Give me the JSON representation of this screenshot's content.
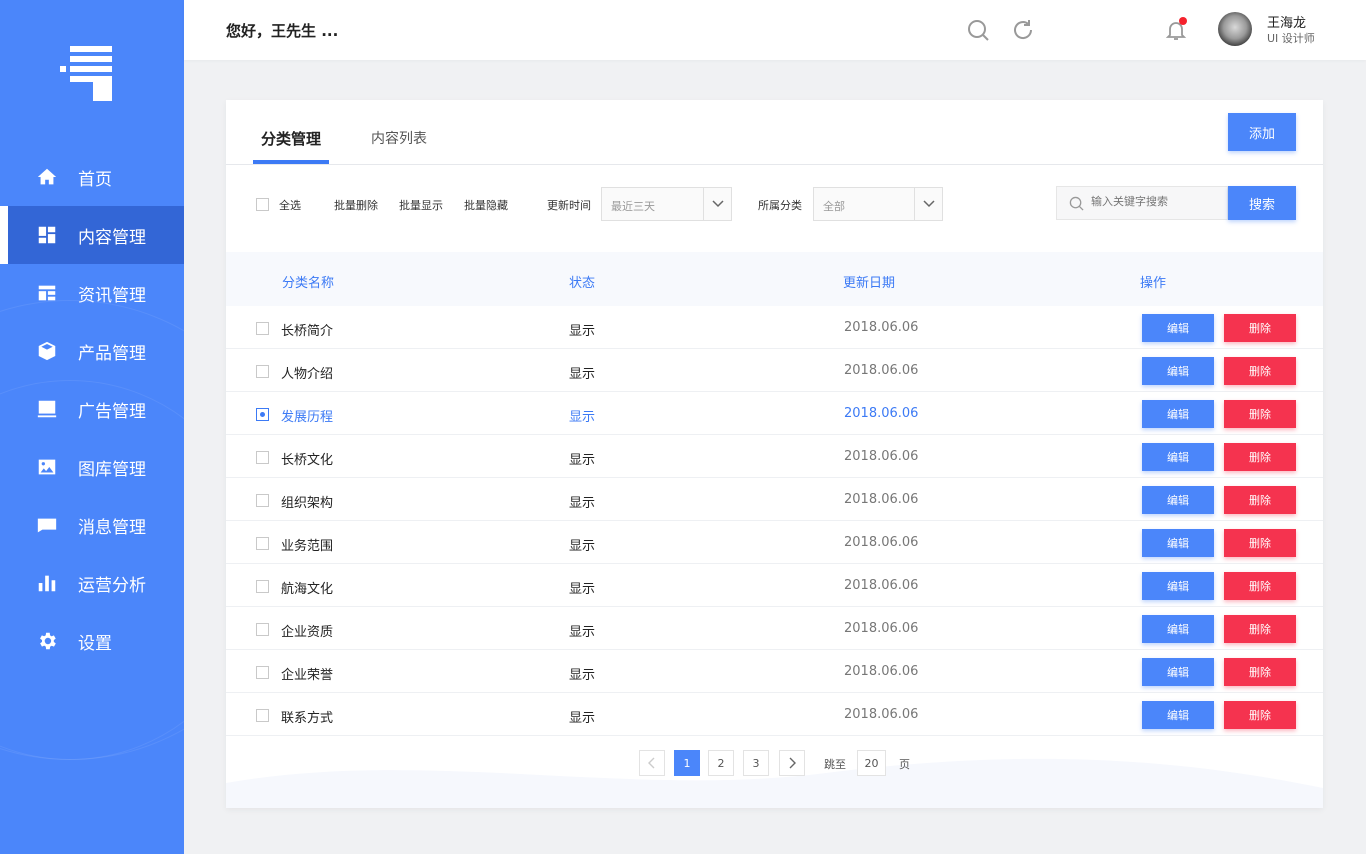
{
  "header": {
    "greeting": "您好，王先生 ...",
    "user_name": "王海龙",
    "user_role": "UI 设计师"
  },
  "sidebar": {
    "items": [
      {
        "label": "首页",
        "icon": "home-icon"
      },
      {
        "label": "内容管理",
        "icon": "dashboard-icon",
        "active": true
      },
      {
        "label": "资讯管理",
        "icon": "news-icon"
      },
      {
        "label": "产品管理",
        "icon": "box-icon"
      },
      {
        "label": "广告管理",
        "icon": "monitor-icon"
      },
      {
        "label": "图库管理",
        "icon": "image-icon"
      },
      {
        "label": "消息管理",
        "icon": "message-icon"
      },
      {
        "label": "运营分析",
        "icon": "bar-chart-icon"
      },
      {
        "label": "设置",
        "icon": "gear-icon"
      }
    ]
  },
  "tabs": [
    "分类管理",
    "内容列表"
  ],
  "add_button": "添加",
  "toolbar": {
    "select_all": "全选",
    "batch_delete": "批量删除",
    "batch_show": "批量显示",
    "batch_hide": "批量隐藏",
    "update_time_label": "更新时间",
    "update_time_value": "最近三天",
    "category_label": "所属分类",
    "category_value": "全部",
    "search_placeholder": "输入关键字搜索",
    "search_button": "搜索"
  },
  "table": {
    "columns": [
      "分类名称",
      "状态",
      "更新日期",
      "操作"
    ],
    "rows": [
      {
        "name": "长桥简介",
        "status": "显示",
        "date": "2018.06.06",
        "checked": false
      },
      {
        "name": "人物介绍",
        "status": "显示",
        "date": "2018.06.06",
        "checked": false
      },
      {
        "name": "发展历程",
        "status": "显示",
        "date": "2018.06.06",
        "checked": true
      },
      {
        "name": "长桥文化",
        "status": "显示",
        "date": "2018.06.06",
        "checked": false
      },
      {
        "name": "组织架构",
        "status": "显示",
        "date": "2018.06.06",
        "checked": false
      },
      {
        "name": "业务范围",
        "status": "显示",
        "date": "2018.06.06",
        "checked": false
      },
      {
        "name": "航海文化",
        "status": "显示",
        "date": "2018.06.06",
        "checked": false
      },
      {
        "name": "企业资质",
        "status": "显示",
        "date": "2018.06.06",
        "checked": false
      },
      {
        "name": "企业荣誉",
        "status": "显示",
        "date": "2018.06.06",
        "checked": false
      },
      {
        "name": "联系方式",
        "status": "显示",
        "date": "2018.06.06",
        "checked": false
      }
    ],
    "edit_label": "编辑",
    "delete_label": "删除"
  },
  "pagination": {
    "pages": [
      "1",
      "2",
      "3"
    ],
    "current": "1",
    "jump_label": "跳至",
    "jump_value": "20",
    "page_suffix": "页"
  },
  "colors": {
    "primary": "#4b86fa",
    "danger": "#f5334f",
    "sidebar_active": "#3366d6"
  }
}
